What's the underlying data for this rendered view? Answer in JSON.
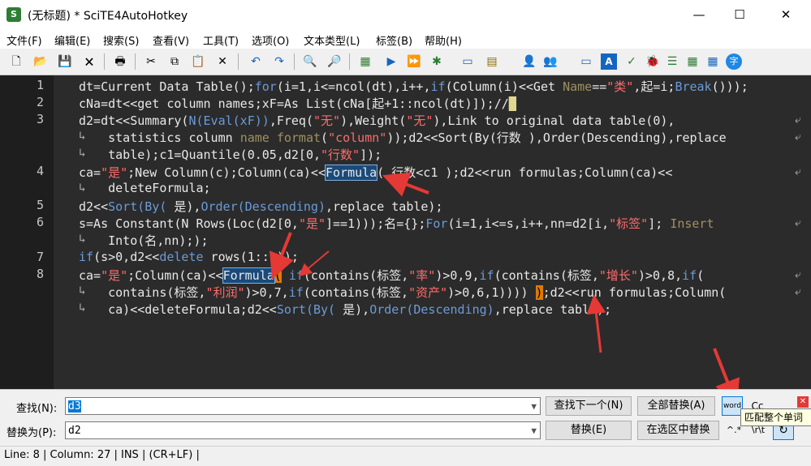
{
  "window": {
    "title": "(无标题) * SciTE4AutoHotkey",
    "minimize": "—",
    "maximize": "☐",
    "close": "✕",
    "app_icon": "scite-icon"
  },
  "menu": [
    "文件(F)",
    "编辑(E)",
    "搜索(S)",
    "查看(V)",
    "工具(T)",
    "选项(O)",
    "文本类型(L)",
    "标签(B)",
    "帮助(H)"
  ],
  "editor": {
    "line_numbers": [
      "1",
      "2",
      "3",
      "4",
      "5",
      "6",
      "7",
      "8"
    ],
    "wrap_mark": "↳",
    "wrap_end": "⤶"
  },
  "find": {
    "find_label": "查找(N):",
    "find_value": "d3",
    "replace_label": "替换为(P):",
    "replace_value": "d2",
    "find_next": "查找下一个(N)",
    "replace_all": "全部替换(A)",
    "replace": "替换(E)",
    "replace_in_selection": "在选区中替换",
    "word_toggle": "word",
    "case_toggle": "Cc",
    "regex_toggle": "^.*",
    "backslash_toggle": "\\r\\t",
    "wrap_toggle": "↻",
    "tooltip": "匹配整个单词"
  },
  "status": "Line: 8 | Column: 27 | INS | (CR+LF) |",
  "colors": {
    "editor_bg": "#2b2b2b",
    "keyword": "#6b9bd8",
    "string": "#ff6b6b",
    "highlight": "#1a4a7a",
    "brace_match": "#e07a00",
    "annotation_arrow": "#e53935"
  }
}
